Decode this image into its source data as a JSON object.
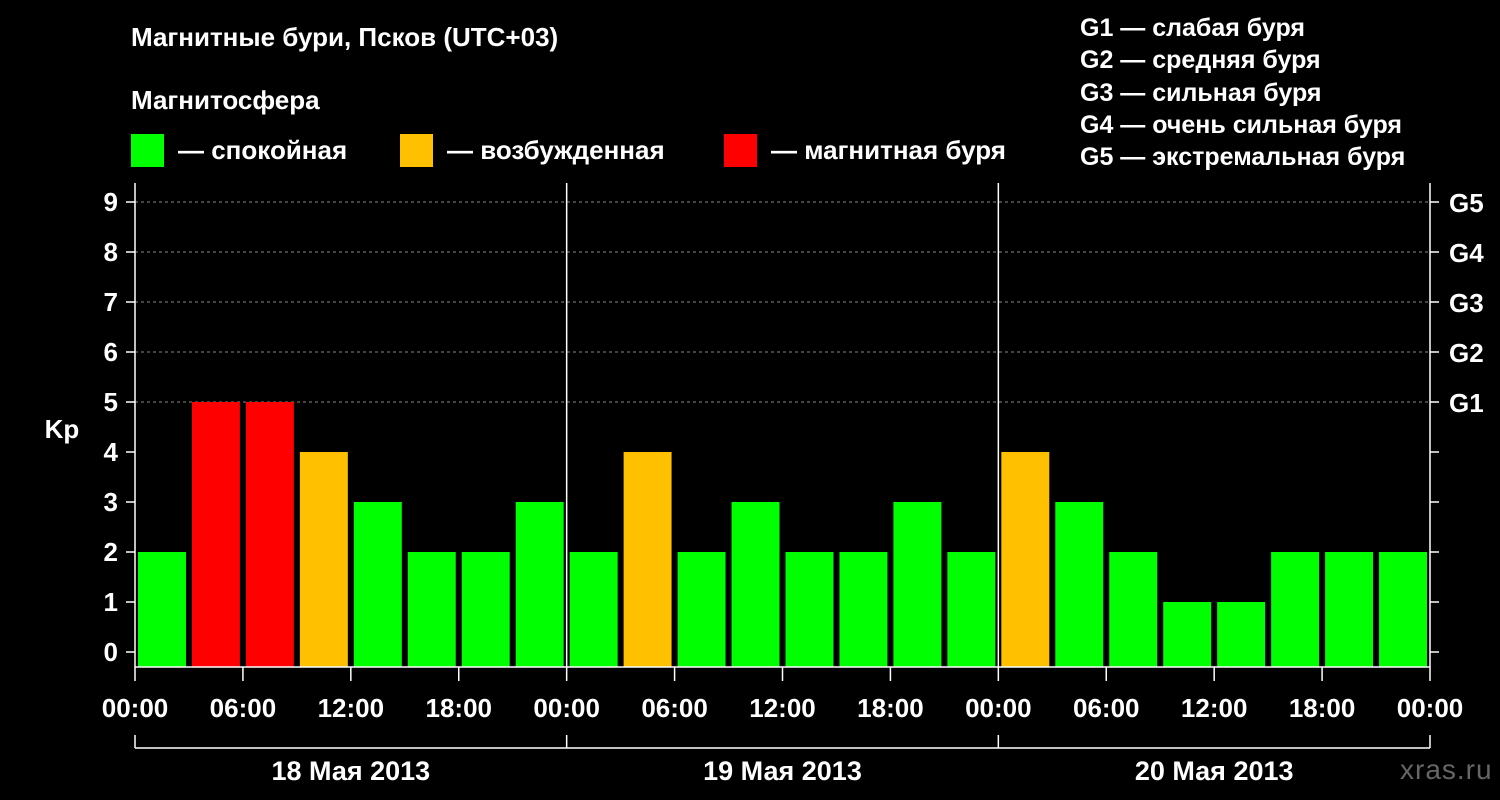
{
  "title": "Магнитные бури, Псков (UTC+03)",
  "legend": {
    "heading": "Магнитосфера",
    "items": [
      {
        "label": "— спокойная",
        "color": "#00ff00"
      },
      {
        "label": "— возбужденная",
        "color": "#ffc000"
      },
      {
        "label": "— магнитная буря",
        "color": "#ff0000"
      }
    ]
  },
  "g_scale": [
    "G1 — слабая буря",
    "G2 — средняя буря",
    "G3 — сильная буря",
    "G4 — очень сильная буря",
    "G5 — экстремальная буря"
  ],
  "watermark": "xras.ru",
  "chart_data": {
    "type": "bar",
    "ylabel": "Kp",
    "ylim": [
      0,
      9
    ],
    "y_ticks": [
      0,
      1,
      2,
      3,
      4,
      5,
      6,
      7,
      8,
      9
    ],
    "right_ticks": [
      {
        "value": 5,
        "label": "G1"
      },
      {
        "value": 6,
        "label": "G2"
      },
      {
        "value": 7,
        "label": "G3"
      },
      {
        "value": 8,
        "label": "G4"
      },
      {
        "value": 9,
        "label": "G5"
      }
    ],
    "grid": "dashed horizontal at 5–9",
    "x_tick_labels": [
      "00:00",
      "06:00",
      "12:00",
      "18:00",
      "00:00",
      "06:00",
      "12:00",
      "18:00",
      "00:00",
      "06:00",
      "12:00",
      "18:00",
      "00:00"
    ],
    "days": [
      "18 Мая 2013",
      "19 Мая 2013",
      "20 Мая 2013"
    ],
    "interval_hours": 3,
    "values": [
      2,
      5,
      5,
      4,
      3,
      2,
      2,
      3,
      2,
      4,
      2,
      3,
      2,
      2,
      3,
      2,
      4,
      3,
      2,
      1,
      1,
      2,
      2,
      2
    ],
    "status_colors": {
      "quiet": "#00ff00",
      "active": "#ffc000",
      "storm": "#ff0000"
    },
    "status": [
      "quiet",
      "storm",
      "storm",
      "active",
      "quiet",
      "quiet",
      "quiet",
      "quiet",
      "quiet",
      "active",
      "quiet",
      "quiet",
      "quiet",
      "quiet",
      "quiet",
      "quiet",
      "active",
      "quiet",
      "quiet",
      "quiet",
      "quiet",
      "quiet",
      "quiet",
      "quiet"
    ]
  }
}
